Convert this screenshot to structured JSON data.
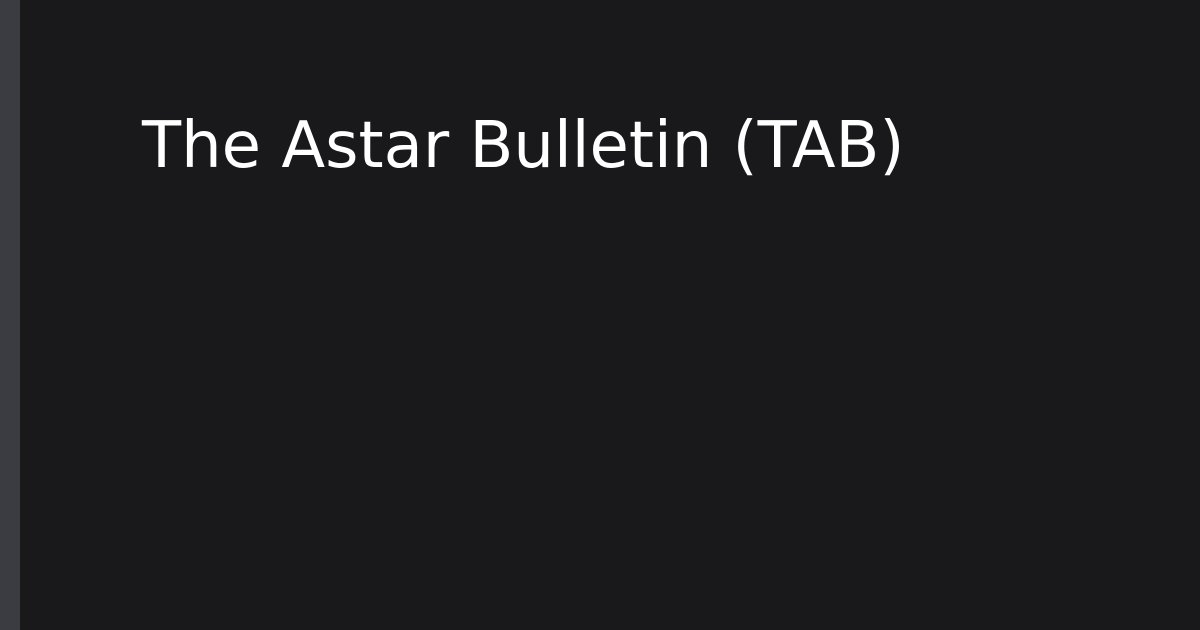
{
  "card": {
    "title": "The Astar Bulletin (TAB)"
  },
  "colors": {
    "background": "#19191b",
    "accent_bar": "#3b3c42",
    "title_text": "#ffffff"
  }
}
